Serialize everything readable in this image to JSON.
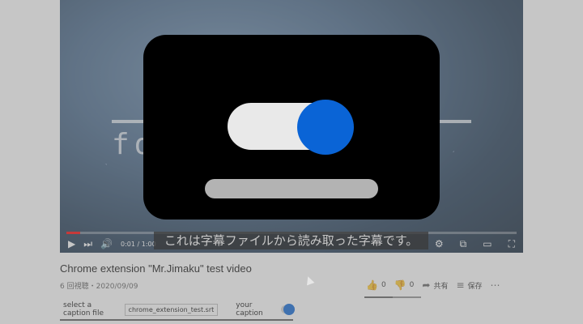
{
  "video": {
    "background_text": "fo                     on",
    "caption_text": "これは字幕ファイルから読み取った字幕です。",
    "time": "0:01 / 1:00",
    "progress_fraction": 0.03,
    "icons": {
      "play": "play-icon",
      "next": "next-icon",
      "volume": "volume-icon",
      "settings": "gear-icon",
      "miniplayer": "miniplayer-icon",
      "theater": "theater-icon",
      "fullscreen": "fullscreen-icon"
    }
  },
  "below": {
    "title": "Chrome extension \"Mr.Jimaku\" test video",
    "meta": "6 回視聴・2020/09/09",
    "likes": "0",
    "dislikes": "0",
    "share_label": "共有",
    "save_label": "保存",
    "more_label": "⋯",
    "sentiment_fraction": 0.5
  },
  "extension": {
    "select_label": "select a caption file",
    "file_name": "chrome_extension_test.srt",
    "your_caption_label": "your caption",
    "toggle_on": true,
    "accent": "#0a64d6"
  }
}
